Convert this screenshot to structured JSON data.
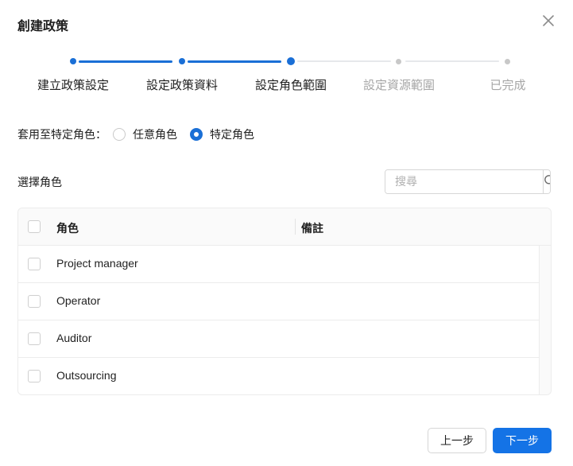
{
  "dialog": {
    "title": "創建政策"
  },
  "stepper": {
    "steps": [
      {
        "label": "建立政策設定",
        "state": "done"
      },
      {
        "label": "設定政策資料",
        "state": "done"
      },
      {
        "label": "設定角色範圍",
        "state": "current"
      },
      {
        "label": "設定資源範圍",
        "state": "todo"
      },
      {
        "label": "已完成",
        "state": "todo"
      }
    ]
  },
  "scope": {
    "label": "套用至特定角色：",
    "options": [
      {
        "label": "任意角色",
        "checked": false
      },
      {
        "label": "特定角色",
        "checked": true
      }
    ]
  },
  "role_select": {
    "label": "選擇角色",
    "search_placeholder": "搜尋"
  },
  "table": {
    "columns": [
      "角色",
      "備註"
    ],
    "rows": [
      {
        "role": "Project manager",
        "note": ""
      },
      {
        "role": "Operator",
        "note": ""
      },
      {
        "role": "Auditor",
        "note": ""
      },
      {
        "role": "Outsourcing",
        "note": ""
      }
    ]
  },
  "footer": {
    "prev_label": "上一步",
    "next_label": "下一步"
  },
  "colors": {
    "accent": "#1473e6",
    "step_done": "#1a6fd6",
    "step_todo": "#c8c8c8"
  },
  "icons": {
    "close": "close-icon",
    "search": "search-icon"
  }
}
